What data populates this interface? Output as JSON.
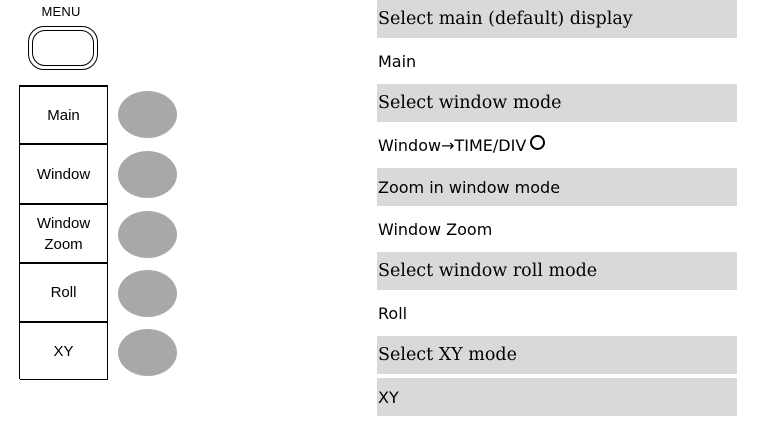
{
  "menu": {
    "label": "MENU"
  },
  "softkeys": [
    {
      "label": "Main"
    },
    {
      "label": "Window"
    },
    {
      "label_line1": "Window",
      "label_line2": "Zoom"
    },
    {
      "label": "Roll"
    },
    {
      "label": "XY"
    }
  ],
  "descriptions": [
    {
      "text": "Select main (default) display"
    },
    {
      "text": "Main"
    },
    {
      "text": "Select window mode"
    },
    {
      "text": "Window→TIME/DIV"
    },
    {
      "text": "Zoom in window mode"
    },
    {
      "text": "Window Zoom"
    },
    {
      "text": "Select window roll mode"
    },
    {
      "text": "Roll"
    },
    {
      "text": "Select XY mode"
    },
    {
      "text": "XY"
    }
  ],
  "icons": {
    "knob": "variable-knob-icon"
  },
  "colors": {
    "row_shade": "#d9d9d9",
    "bezel_button": "#a8a8a8"
  }
}
